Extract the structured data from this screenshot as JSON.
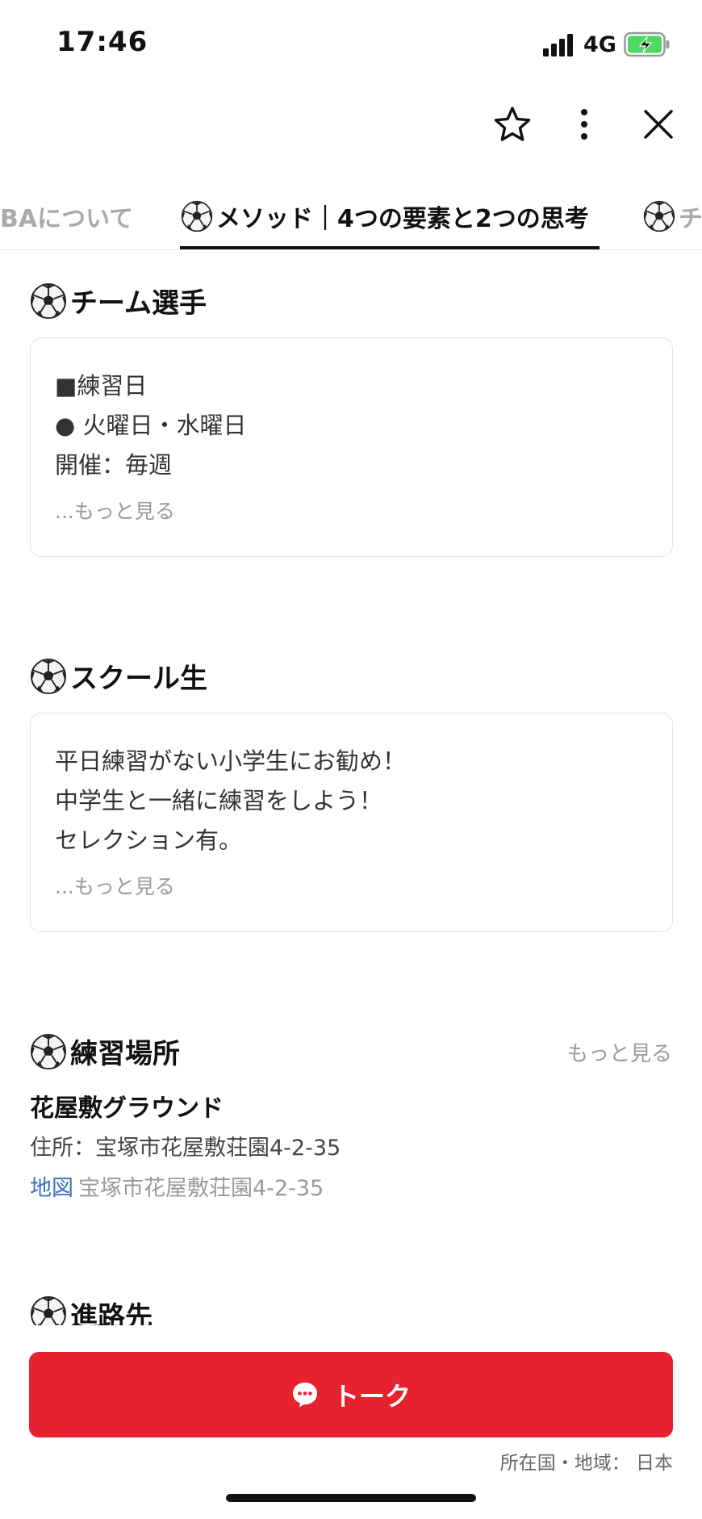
{
  "status_bar": {
    "time": "17:46",
    "network": "4G"
  },
  "header": {
    "star_icon": "star-outline-icon",
    "more_icon": "more-vertical-icon",
    "close_icon": "close-icon"
  },
  "tabs": [
    {
      "label": "BAについて",
      "icon": ""
    },
    {
      "label": "メソッド｜4つの要素と2つの思考",
      "icon": "soccer-ball-icon",
      "active": true
    },
    {
      "label": "チ",
      "icon": "soccer-ball-icon"
    }
  ],
  "sections": {
    "team": {
      "title": "チーム選手",
      "lines": [
        "■練習日",
        "● 火曜日・水曜日",
        "開催：毎週"
      ],
      "more": "...もっと見る"
    },
    "school": {
      "title": "スクール生",
      "lines": [
        "平日練習がない小学生にお勧め！",
        "中学生と一緒に練習をしよう！",
        "セレクション有。"
      ],
      "more": "...もっと見る"
    },
    "place": {
      "title": "練習場所",
      "more": "もっと見る",
      "name": "花屋敷グラウンド",
      "address": "住所：宝塚市花屋敷荘園4-2-35",
      "map_label": "地図",
      "map_address": "宝塚市花屋敷荘園4-2-35"
    },
    "career": {
      "title": "進路先"
    }
  },
  "talk_button": {
    "label": "トーク"
  },
  "footer": {
    "country": "所在国・地域： 日本"
  },
  "colors": {
    "accent": "#e8212e",
    "link": "#3d6fc5",
    "muted": "#9a9a9a"
  }
}
